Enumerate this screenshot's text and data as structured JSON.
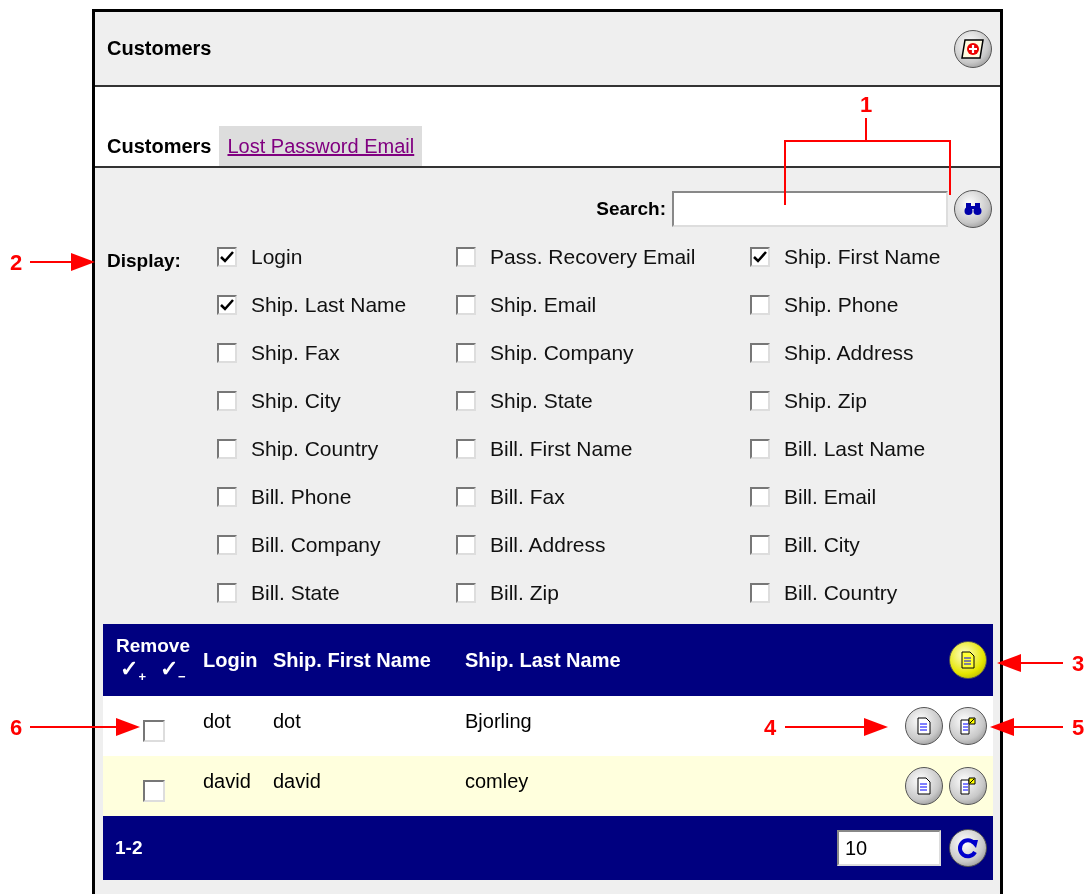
{
  "header": {
    "title": "Customers"
  },
  "tabs": [
    {
      "label": "Customers",
      "selected": true
    },
    {
      "label": "Lost Password Email",
      "selected": false
    }
  ],
  "search": {
    "label": "Search:"
  },
  "display": {
    "label": "Display:",
    "options": [
      {
        "label": "Login",
        "checked": true
      },
      {
        "label": "Pass. Recovery Email",
        "checked": false
      },
      {
        "label": "Ship. First Name",
        "checked": true
      },
      {
        "label": "Ship. Last Name",
        "checked": true
      },
      {
        "label": "Ship. Email",
        "checked": false
      },
      {
        "label": "Ship. Phone",
        "checked": false
      },
      {
        "label": "Ship. Fax",
        "checked": false
      },
      {
        "label": "Ship. Company",
        "checked": false
      },
      {
        "label": "Ship. Address",
        "checked": false
      },
      {
        "label": "Ship. City",
        "checked": false
      },
      {
        "label": "Ship. State",
        "checked": false
      },
      {
        "label": "Ship. Zip",
        "checked": false
      },
      {
        "label": "Ship. Country",
        "checked": false
      },
      {
        "label": "Bill. First Name",
        "checked": false
      },
      {
        "label": "Bill. Last Name",
        "checked": false
      },
      {
        "label": "Bill. Phone",
        "checked": false
      },
      {
        "label": "Bill. Fax",
        "checked": false
      },
      {
        "label": "Bill. Email",
        "checked": false
      },
      {
        "label": "Bill. Company",
        "checked": false
      },
      {
        "label": "Bill. Address",
        "checked": false
      },
      {
        "label": "Bill. City",
        "checked": false
      },
      {
        "label": "Bill. State",
        "checked": false
      },
      {
        "label": "Bill. Zip",
        "checked": false
      },
      {
        "label": "Bill. Country",
        "checked": false
      }
    ]
  },
  "table": {
    "remove_label": "Remove",
    "check_all": "✓$_{+}$",
    "uncheck_all": "✓$_{−}$",
    "columns": [
      "Login",
      "Ship. First Name",
      "Ship. Last Name"
    ],
    "rows": [
      {
        "checked": false,
        "cells": [
          "dot",
          "dot",
          "Bjorling"
        ]
      },
      {
        "checked": false,
        "cells": [
          "david",
          "david",
          "comley"
        ]
      }
    ]
  },
  "footer": {
    "range": "1-2",
    "page_size": "10"
  },
  "callouts": [
    {
      "label": "1"
    },
    {
      "label": "2"
    },
    {
      "label": "3"
    },
    {
      "label": "6"
    },
    {
      "label": "4"
    },
    {
      "label": "5"
    }
  ]
}
